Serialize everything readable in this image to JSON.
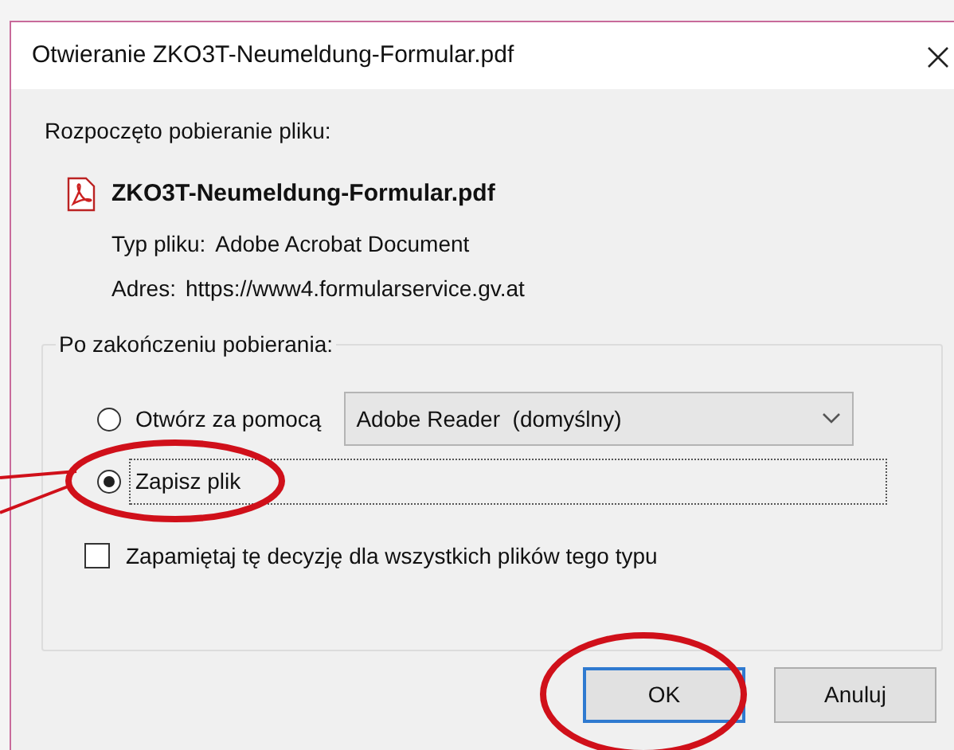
{
  "window": {
    "title": "Otwieranie ZKO3T-Neumeldung-Formular.pdf"
  },
  "intro": "Rozpoczęto pobieranie pliku:",
  "file": {
    "name": "ZKO3T-Neumeldung-Formular.pdf",
    "type_label": "Typ pliku:",
    "type_value": "Adobe Acrobat Document",
    "address_label": "Adres:",
    "address_value": "https://www4.formularservice.gv.at"
  },
  "group": {
    "legend": "Po zakończeniu pobierania:",
    "options": [
      {
        "kind": "radio",
        "label": "Otwórz za pomocą",
        "selected": false,
        "focused": false,
        "dropdown": "Adobe Reader  (domyślny)"
      },
      {
        "kind": "radio",
        "label": "Zapisz plik",
        "selected": true,
        "focused": true
      },
      {
        "kind": "checkbox",
        "label": "Zapamiętaj tę decyzję dla wszystkich plików tego typu",
        "checked": false
      }
    ]
  },
  "buttons": [
    {
      "label": "OK",
      "default": true
    },
    {
      "label": "Anuluj",
      "default": false
    }
  ]
}
